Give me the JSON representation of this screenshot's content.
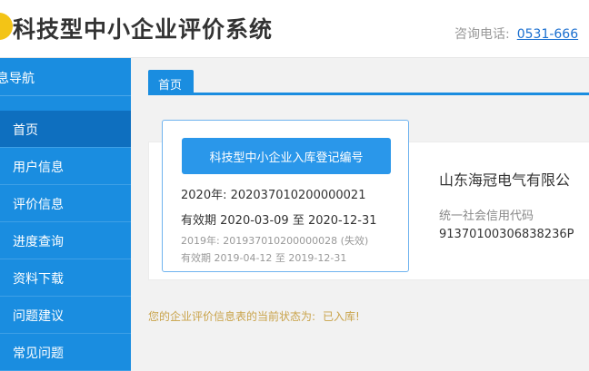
{
  "header": {
    "title": "科技型中小企业评价系统",
    "hotline_label": "咨询电话:",
    "hotline_number": "0531-666"
  },
  "sidebar": {
    "heading": "息导航",
    "items": [
      {
        "label": "首页",
        "active": true
      },
      {
        "label": "用户信息",
        "active": false
      },
      {
        "label": "评价信息",
        "active": false
      },
      {
        "label": "进度查询",
        "active": false
      },
      {
        "label": "资料下载",
        "active": false
      },
      {
        "label": "问题建议",
        "active": false
      },
      {
        "label": "常见问题",
        "active": false
      }
    ]
  },
  "tabs": [
    {
      "label": "首页"
    }
  ],
  "card": {
    "button_label": "科技型中小企业入库登记编号",
    "current_registration": "2020年:  202037010200000021",
    "current_validity": "有效期 2020-03-09 至 2020-12-31",
    "previous_registration": "2019年:  201937010200000028 (失效)",
    "previous_validity": "有效期 2019-04-12 至 2019-12-31"
  },
  "company": {
    "name": "山东海冠电气有限公",
    "credit_code_label": "统一社会信用代码",
    "credit_code": "91370100306838236P"
  },
  "status": {
    "text": "您的企业评价信息表的当前状态为:",
    "value": "已入库!"
  },
  "colors": {
    "primary": "#1a8de0",
    "active_nav": "#0e6fbf",
    "button": "#2a97ea",
    "status_text": "#c9a34a",
    "logo": "#f3c416"
  }
}
